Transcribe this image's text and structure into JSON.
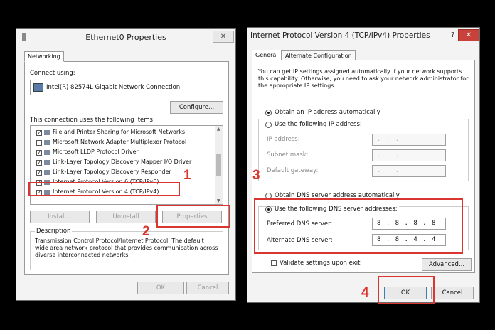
{
  "left_dialog": {
    "title": "Ethernet0 Properties",
    "close_glyph": "✕",
    "tab_networking": "Networking",
    "connect_using_label": "Connect using:",
    "adapter_name": "Intel(R) 82574L Gigabit Network Connection",
    "configure_button": "Configure...",
    "items_label": "This connection uses the following items:",
    "items": [
      {
        "label": "File and Printer Sharing for Microsoft Networks",
        "checked": true
      },
      {
        "label": "Microsoft Network Adapter Multiplexor Protocol",
        "checked": false
      },
      {
        "label": "Microsoft LLDP Protocol Driver",
        "checked": true
      },
      {
        "label": "Link-Layer Topology Discovery Mapper I/O Driver",
        "checked": true
      },
      {
        "label": "Link-Layer Topology Discovery Responder",
        "checked": true
      },
      {
        "label": "Internet Protocol Version 6 (TCP/IPv6)",
        "checked": true
      },
      {
        "label": "Internet Protocol Version 4 (TCP/IPv4)",
        "checked": true
      }
    ],
    "install_button": "Install...",
    "uninstall_button": "Uninstall",
    "properties_button": "Properties",
    "description_label": "Description",
    "description_text": "Transmission Control Protocol/Internet Protocol. The default wide area network protocol that provides communication across diverse interconnected networks.",
    "ok_button": "OK",
    "cancel_button": "Cancel"
  },
  "right_dialog": {
    "title": "Internet Protocol Version 4 (TCP/IPv4) Properties",
    "help_glyph": "?",
    "close_glyph": "✕",
    "tab_general": "General",
    "tab_alternate": "Alternate Configuration",
    "intro": "You can get IP settings assigned automatically if your network supports this capability. Otherwise, you need to ask your network administrator for the appropriate IP settings.",
    "obtain_ip_auto": "Obtain an IP address automatically",
    "use_following_ip": "Use the following IP address:",
    "ip_address_label": "IP address:",
    "subnet_mask_label": "Subnet mask:",
    "default_gateway_label": "Default gateway:",
    "empty_ip": ".   .   .",
    "obtain_dns_auto": "Obtain DNS server address automatically",
    "use_following_dns": "Use the following DNS server addresses:",
    "preferred_dns_label": "Preferred DNS server:",
    "preferred_dns_value": "8 . 8 . 8 . 8",
    "alternate_dns_label": "Alternate DNS server:",
    "alternate_dns_value": "8 . 8 . 4 . 4",
    "validate_label": "Validate settings upon exit",
    "advanced_button": "Advanced...",
    "ok_button": "OK",
    "cancel_button": "Cancel"
  },
  "step_numbers": {
    "one": "1",
    "two": "2",
    "three": "3",
    "four": "4"
  },
  "colors": {
    "highlight": "#d9362f",
    "background": "#000000"
  }
}
